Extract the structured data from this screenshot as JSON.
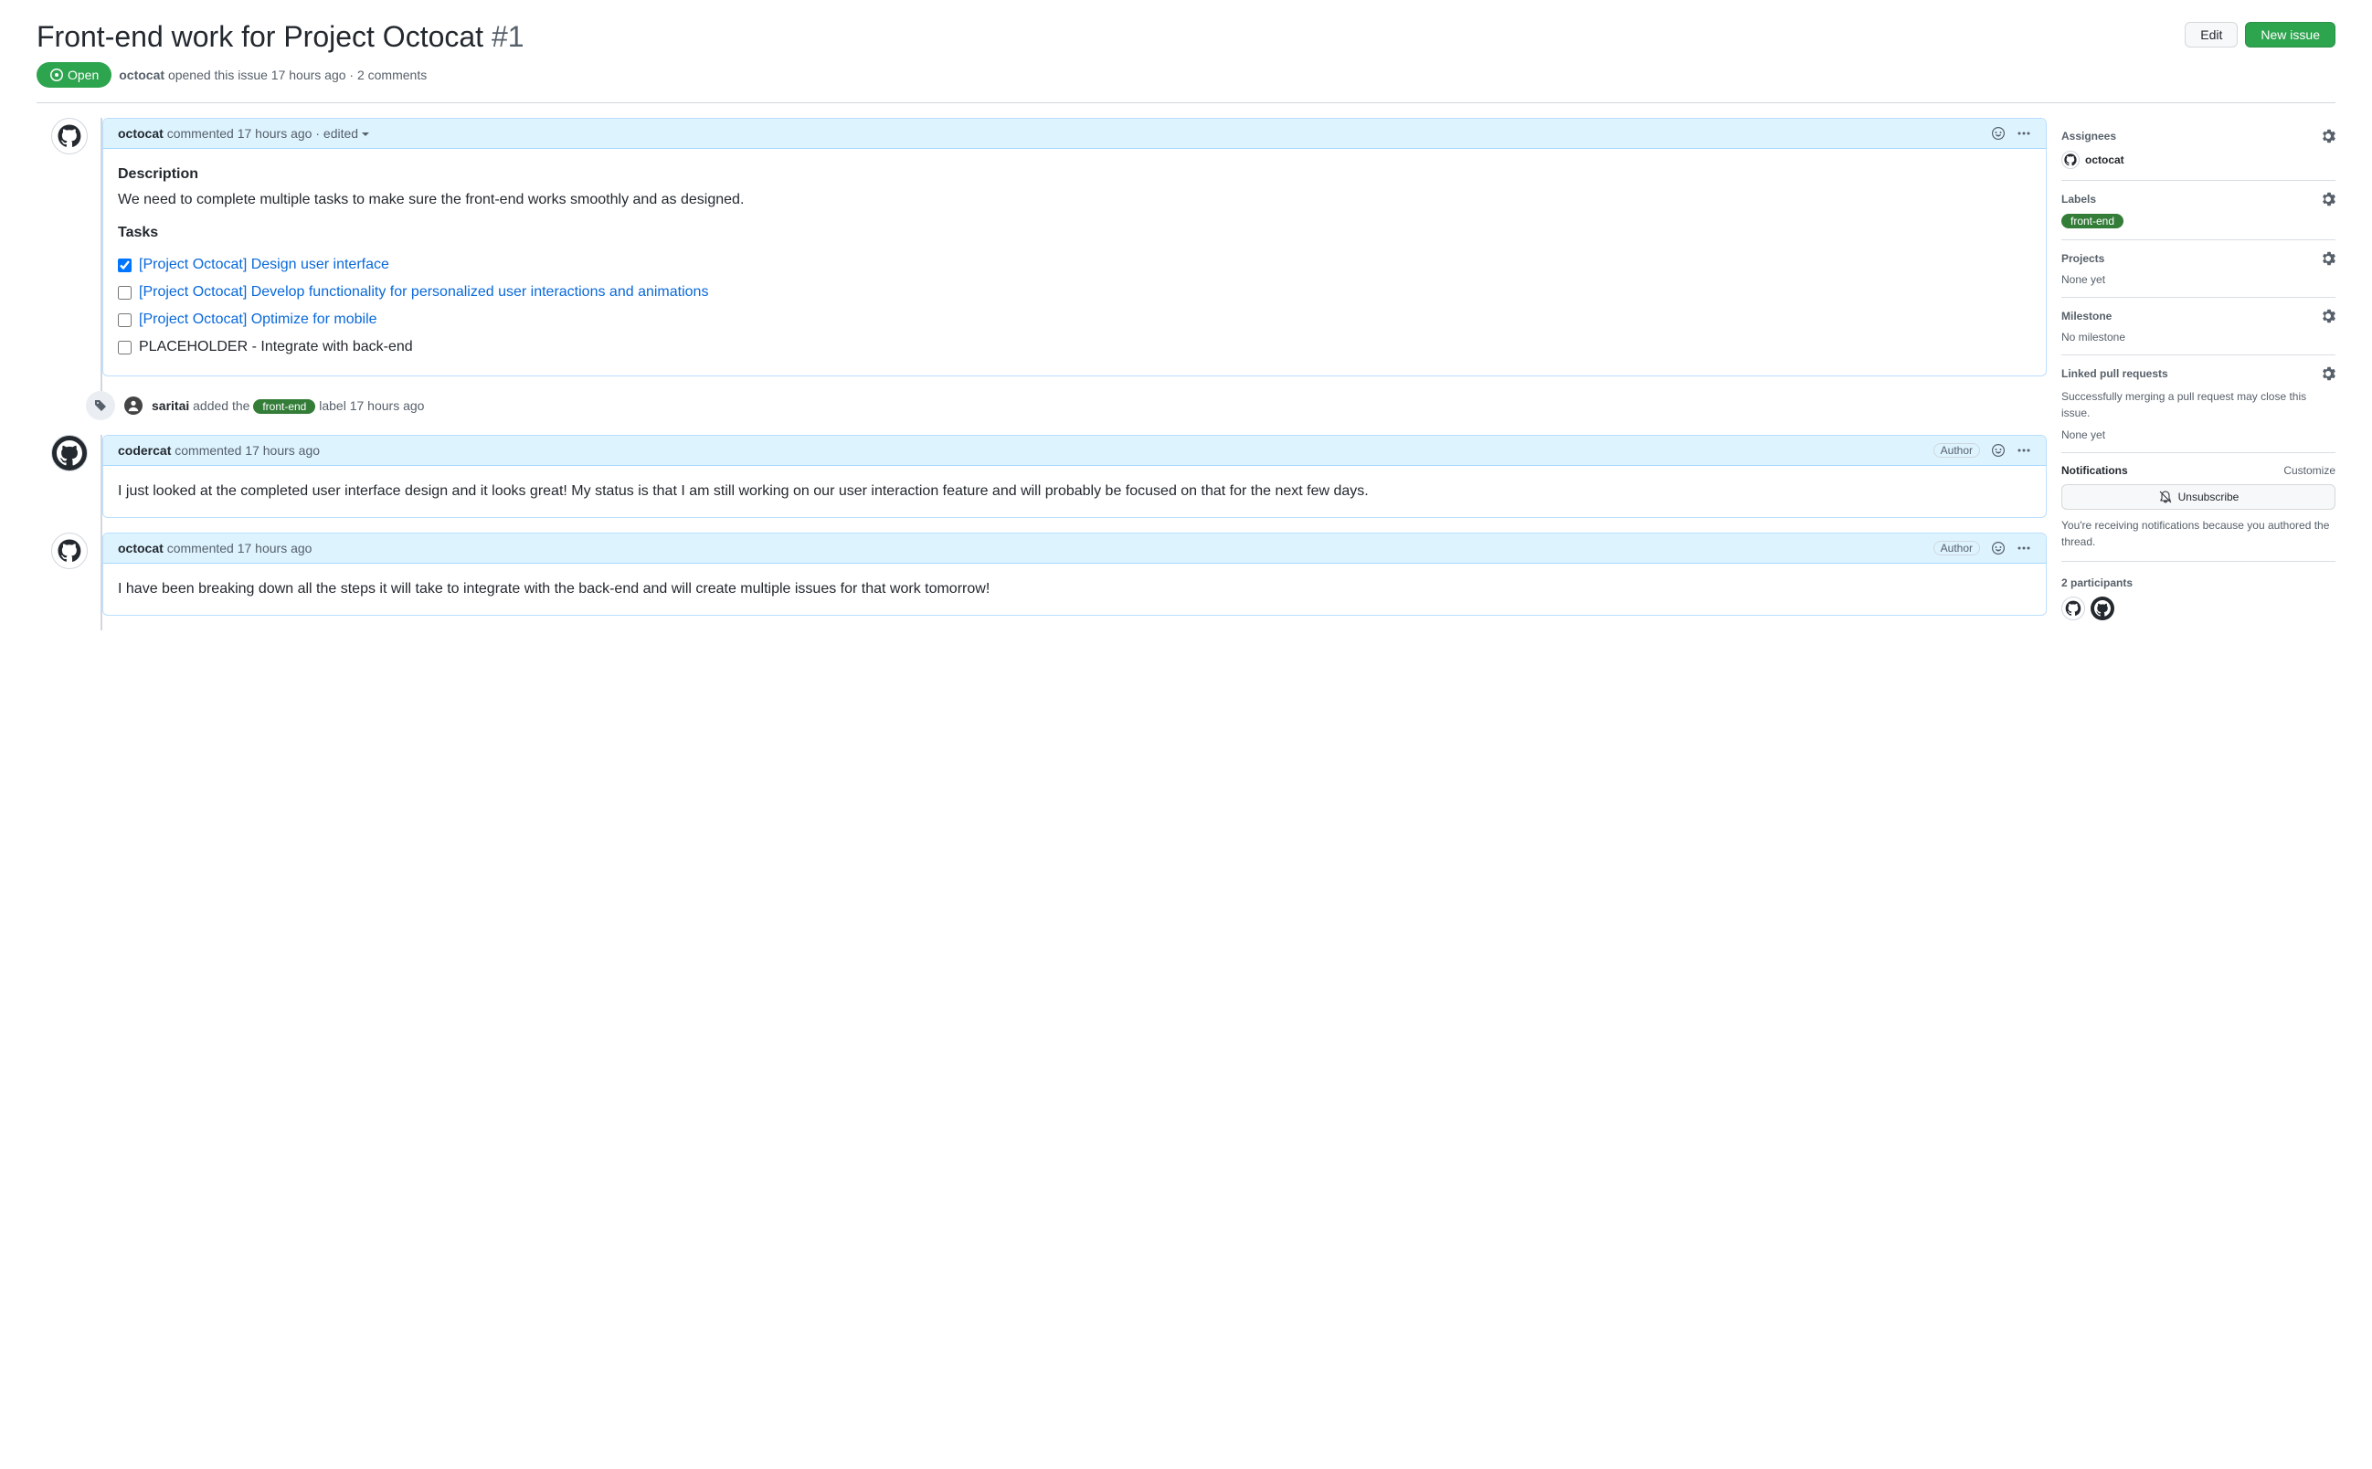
{
  "issue": {
    "title": "Front-end work for Project Octocat",
    "number": "#1",
    "state": "Open",
    "author": "octocat",
    "opened_text": "opened this issue 17 hours ago · 2 comments"
  },
  "header_actions": {
    "edit": "Edit",
    "new_issue": "New issue"
  },
  "comments": [
    {
      "author": "octocat",
      "meta": "commented 17 hours ago",
      "edited": "edited",
      "highlighted": true,
      "badge": null,
      "body": {
        "heading1": "Description",
        "para1": "We need to complete multiple tasks to make sure the front-end works smoothly and as designed.",
        "heading2": "Tasks",
        "tasks": [
          {
            "checked": true,
            "text": "[Project Octocat] Design user interface",
            "link": true
          },
          {
            "checked": false,
            "text": "[Project Octocat] Develop functionality for personalized user interactions and animations",
            "link": true
          },
          {
            "checked": false,
            "text": "[Project Octocat] Optimize for mobile",
            "link": true
          },
          {
            "checked": false,
            "text": "PLACEHOLDER - Integrate with back-end",
            "link": false
          }
        ]
      }
    },
    {
      "author": "codercat",
      "meta": "commented 17 hours ago",
      "badge": "Author",
      "body_text": "I just looked at the completed user interface design and it looks great! My status is that I am still working on our user interaction feature and will probably be focused on that for the next few days."
    },
    {
      "author": "octocat",
      "meta": "commented 17 hours ago",
      "badge": "Author",
      "body_text": "I have been breaking down all the steps it will take to integrate with the back-end and will create multiple issues for that work tomorrow!"
    }
  ],
  "event": {
    "actor": "saritai",
    "pre_text": "added the",
    "label": "front-end",
    "post_text": "label 17 hours ago"
  },
  "sidebar": {
    "assignees": {
      "title": "Assignees",
      "items": [
        {
          "name": "octocat"
        }
      ]
    },
    "labels": {
      "title": "Labels",
      "items": [
        "front-end"
      ]
    },
    "projects": {
      "title": "Projects",
      "body": "None yet"
    },
    "milestone": {
      "title": "Milestone",
      "body": "No milestone"
    },
    "linked_prs": {
      "title": "Linked pull requests",
      "desc": "Successfully merging a pull request may close this issue.",
      "body": "None yet"
    },
    "notifications": {
      "title": "Notifications",
      "customize": "Customize",
      "button": "Unsubscribe",
      "note": "You're receiving notifications because you authored the thread."
    },
    "participants": {
      "title": "2 participants"
    }
  }
}
